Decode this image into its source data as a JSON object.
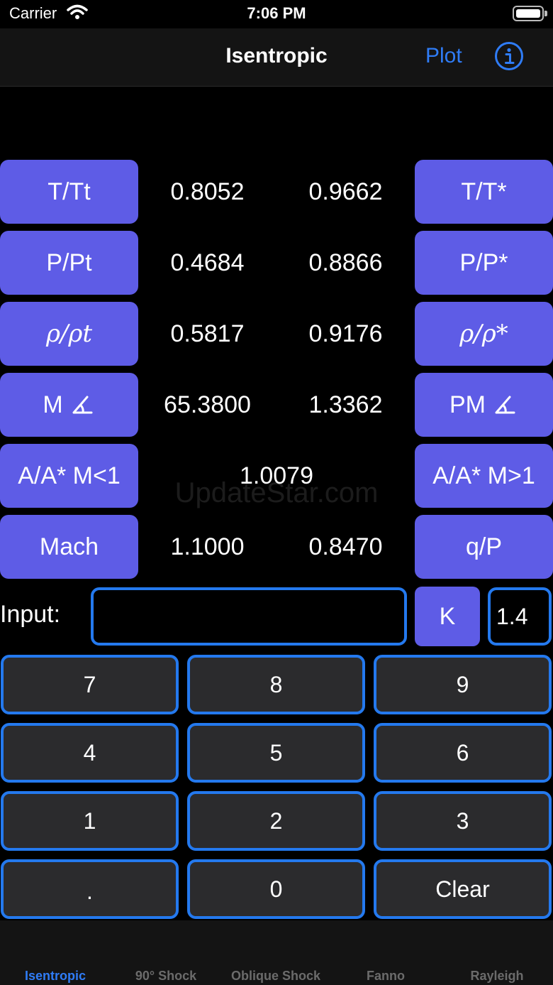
{
  "status_bar": {
    "carrier": "Carrier",
    "time": "7:06 PM"
  },
  "nav": {
    "title": "Isentropic",
    "plot": "Plot",
    "info_icon": "info-circle-icon"
  },
  "rows": [
    {
      "left_label": "T/Tt",
      "left_value": "0.8052",
      "right_value": "0.9662",
      "right_label": "T/T*"
    },
    {
      "left_label": "P/Pt",
      "left_value": "0.4684",
      "right_value": "0.8866",
      "right_label": "P/P*"
    },
    {
      "left_label": "ρ/ρt",
      "left_value": "0.5817",
      "right_value": "0.9176",
      "right_label": "ρ/ρ*"
    },
    {
      "left_label": "M",
      "left_value": "65.3800",
      "right_value": "1.3362",
      "right_label": "PM"
    },
    {
      "left_label": "A/A* M<1",
      "center_value": "1.0079",
      "right_label": "A/A* M>1"
    },
    {
      "left_label": "Mach",
      "left_value": "1.1000",
      "right_value": "0.8470",
      "right_label": "q/P"
    }
  ],
  "angle_icon": "angle-icon",
  "watermark": "UpdateStar.com",
  "input": {
    "label": "Input:",
    "value": "",
    "k_label": "K",
    "k_value": "1.4"
  },
  "keypad": [
    "7",
    "8",
    "9",
    "4",
    "5",
    "6",
    "1",
    "2",
    "3",
    ".",
    "0",
    "Clear"
  ],
  "tabs": [
    {
      "label": "Isentropic",
      "active": true
    },
    {
      "label": "90° Shock",
      "active": false
    },
    {
      "label": "Oblique Shock",
      "active": false
    },
    {
      "label": "Fanno",
      "active": false
    },
    {
      "label": "Rayleigh",
      "active": false
    }
  ],
  "colors": {
    "accent_button": "#5e5ce6",
    "border_blue": "#2479ee",
    "link_blue": "#2f7cf6",
    "key_bg": "#2b2b2d"
  }
}
